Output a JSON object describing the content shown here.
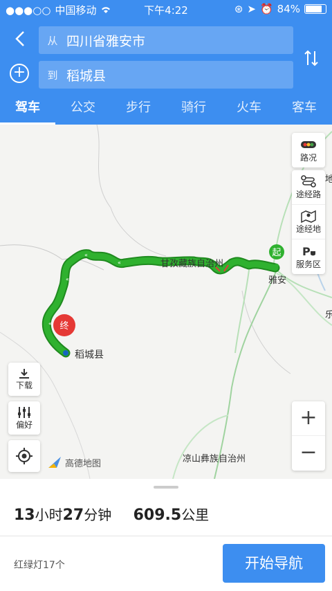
{
  "status": {
    "carrier": "中国移动",
    "time": "下午4:22",
    "battery_percent": "84%",
    "battery_level": 0.84
  },
  "search": {
    "from_prefix": "从",
    "from_value": "四川省雅安市",
    "to_prefix": "到",
    "to_value": "稻城县"
  },
  "tabs": [
    {
      "label": "驾车",
      "active": true
    },
    {
      "label": "公交",
      "active": false
    },
    {
      "label": "步行",
      "active": false
    },
    {
      "label": "骑行",
      "active": false
    },
    {
      "label": "火车",
      "active": false
    },
    {
      "label": "客车",
      "active": false
    }
  ],
  "map": {
    "side_buttons": [
      {
        "label": "路况",
        "icon": "traffic-light-icon"
      },
      {
        "label": "途经路",
        "icon": "route-waypoint-icon"
      },
      {
        "label": "途经地",
        "icon": "map-pin-icon"
      },
      {
        "label": "服务区",
        "icon": "service-area-icon"
      }
    ],
    "download_label": "下载",
    "preference_label": "偏好",
    "zoom_in": "+",
    "zoom_out": "−",
    "logo_text": "高德地图",
    "labels": {
      "region1": "甘孜藏族自治州",
      "region2": "凉山彝族自治州",
      "start_city": "雅安",
      "end_city": "稻城县",
      "start_marker": "起",
      "end_marker": "终",
      "edge1": "乐",
      "edge2": "地"
    },
    "route_color": "#2fb12f",
    "route_outline": "#1f8a1f"
  },
  "summary": {
    "hours": "13",
    "hours_unit": "小时",
    "minutes": "27",
    "minutes_unit": "分钟",
    "distance": "609.5",
    "distance_unit": "公里",
    "traffic_lights": "红绿灯17个",
    "start_nav_label": "开始导航"
  },
  "colors": {
    "primary": "#3d8ef0"
  }
}
